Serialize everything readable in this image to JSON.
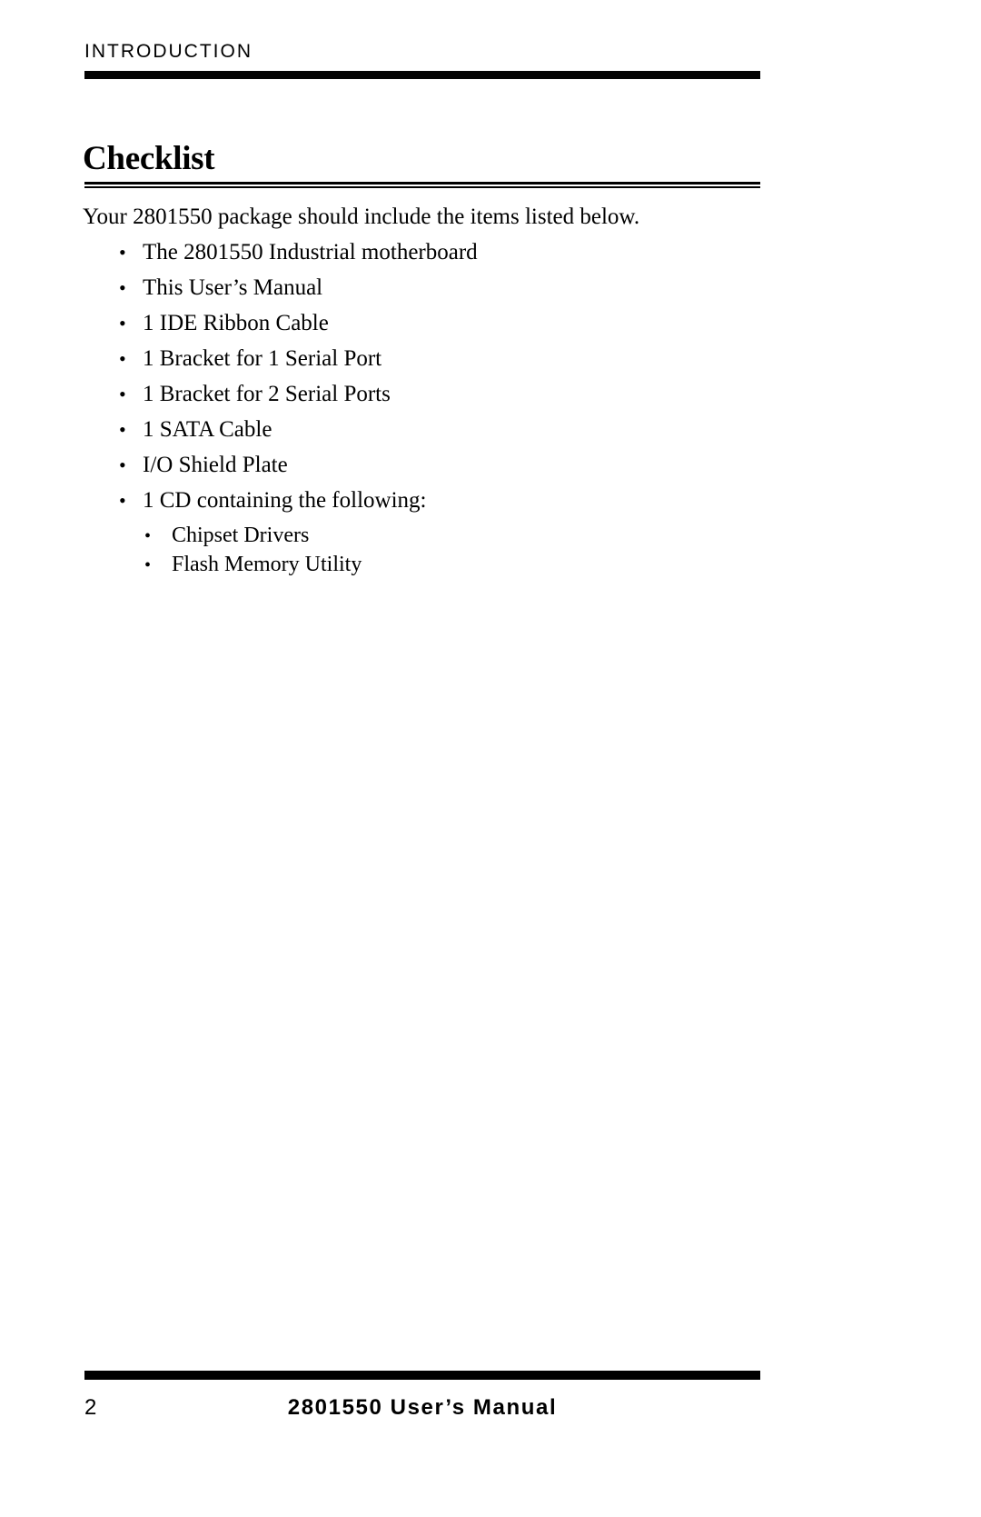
{
  "document": {
    "running_header": "INTRODUCTION",
    "page_background": "#ffffff",
    "text_color": "#000000",
    "rule_color": "#000000"
  },
  "section": {
    "heading": "Checklist",
    "intro": "Your 2801550 package should include the items listed below."
  },
  "checklist": {
    "bullet_glyph": "•",
    "items": [
      {
        "label": "The 2801550 Industrial motherboard"
      },
      {
        "label": "This User’s Manual"
      },
      {
        "label": "1 IDE Ribbon Cable"
      },
      {
        "label": "1 Bracket for 1 Serial Port"
      },
      {
        "label": "1 Bracket for 2 Serial Ports"
      },
      {
        "label": "1 SATA Cable"
      },
      {
        "label": "I/O Shield Plate"
      },
      {
        "label": "1 CD containing the following:"
      }
    ],
    "sub_items": [
      {
        "label": "Chipset Drivers"
      },
      {
        "label": "Flash Memory Utility"
      }
    ]
  },
  "footer": {
    "page_number": "2",
    "title": "2801550 User’s Manual"
  }
}
